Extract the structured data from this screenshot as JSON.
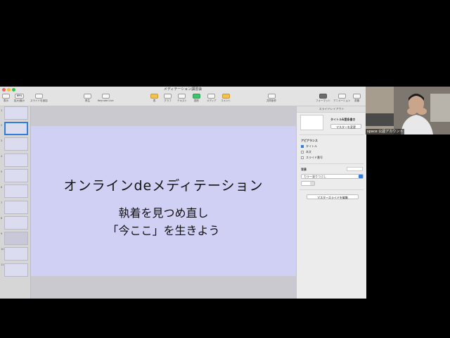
{
  "window": {
    "title": "メディテーション講習会"
  },
  "toolbar": {
    "items": [
      {
        "label": "表示"
      },
      {
        "label": "拡大/縮小"
      },
      {
        "label": "スライドを追加"
      },
      {
        "label": "再生"
      },
      {
        "label": "Keynote Live"
      },
      {
        "label": "表"
      },
      {
        "label": "グラフ"
      },
      {
        "label": "テキスト"
      },
      {
        "label": "図形"
      },
      {
        "label": "メディア"
      },
      {
        "label": "コメント"
      },
      {
        "label": "共同制作"
      },
      {
        "label": "フォーマット"
      },
      {
        "label": "アニメーション"
      },
      {
        "label": "書類"
      }
    ],
    "zoom": "69%"
  },
  "navigator": {
    "slide_numbers": [
      "1",
      "2",
      "3",
      "4",
      "5",
      "6",
      "7",
      "8",
      "9",
      "10",
      "11"
    ]
  },
  "slide": {
    "title": "オンラインdeメディテーション",
    "subtitle_line1": "執着を見つめ直し",
    "subtitle_line2": "「今ここ」を生きよう"
  },
  "inspector": {
    "tab": "スライドレイアウト",
    "master_name": "タイトル&箇条書き",
    "change_master": "マスターを変更",
    "appearance_heading": "アピアランス",
    "checkbox_title": "タイトル",
    "checkbox_body": "本文",
    "checkbox_slide_number": "スライド番号",
    "background_heading": "背景",
    "fill_option": "カラー塗りつぶし",
    "edit_master": "マスタースライドを編集"
  },
  "video": {
    "participant_name": "space 公認アカウント"
  },
  "colors": {
    "accent": "#2f7de1",
    "slide_background": "#d0d0f4"
  }
}
